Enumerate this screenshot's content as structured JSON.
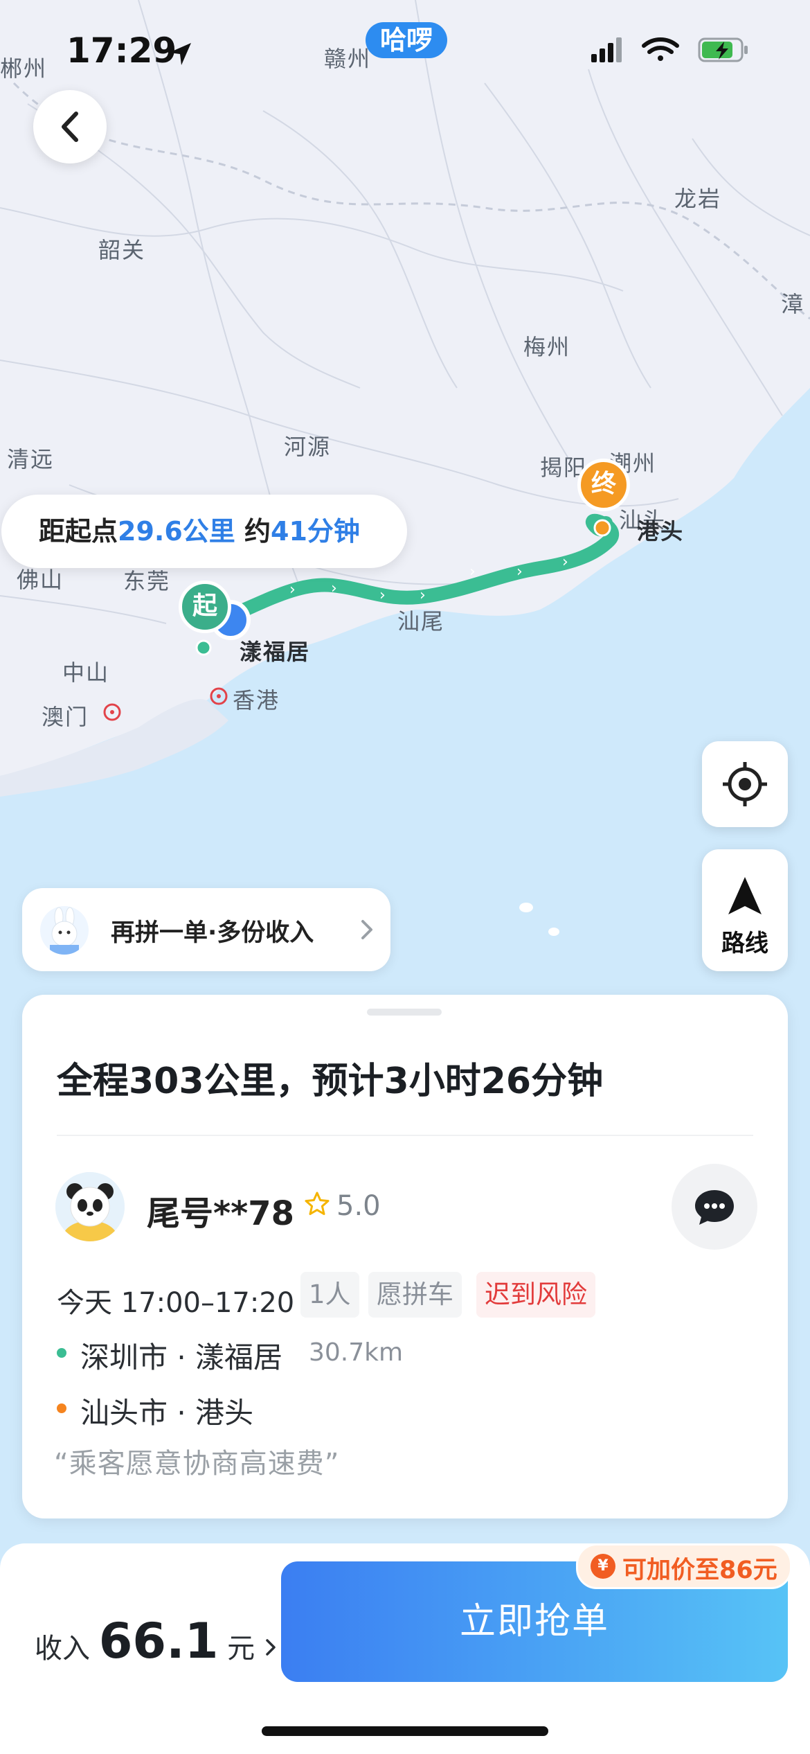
{
  "status_bar": {
    "time": "17:29",
    "app_pill": "哈啰",
    "battery_color": "#3fb950"
  },
  "map": {
    "labels": [
      "郴州",
      "赣州",
      "龙岩",
      "韶关",
      "漳",
      "梅州",
      "河源",
      "清远",
      "揭阳",
      "潮州",
      "汕头",
      "港头",
      "佛山",
      "东莞",
      "汕尾",
      "漾福居",
      "中山",
      "澳门",
      "香港"
    ],
    "start_marker": "起",
    "end_marker": "终",
    "route_color": "#3bbd93",
    "end_color": "#f59a23"
  },
  "distance_card": {
    "prefix": "距起点",
    "distance": "29.6公里",
    "mid": " 约",
    "duration": "41分钟"
  },
  "side_buttons": {
    "route_label": "路线"
  },
  "promo": {
    "text": "再拼一单·多份收入"
  },
  "trip": {
    "summary": "全程303公里，预计3小时26分钟",
    "passenger": {
      "name": "尾号**78",
      "rating": "5.0"
    },
    "time_window": "今天 17:00–17:20",
    "tags": [
      "1人",
      "愿拼车",
      "迟到风险"
    ],
    "origin": {
      "address": "深圳市 · 漾福居",
      "distance": "30.7km"
    },
    "destination": {
      "address": "汕头市 · 港头"
    },
    "note": "“乘客愿意协商高速费”"
  },
  "footer": {
    "income_label": "收入",
    "income_amount": "66.1",
    "income_unit": "元",
    "grab_button": "立即抢单",
    "bonus_text": "可加价至86元"
  }
}
